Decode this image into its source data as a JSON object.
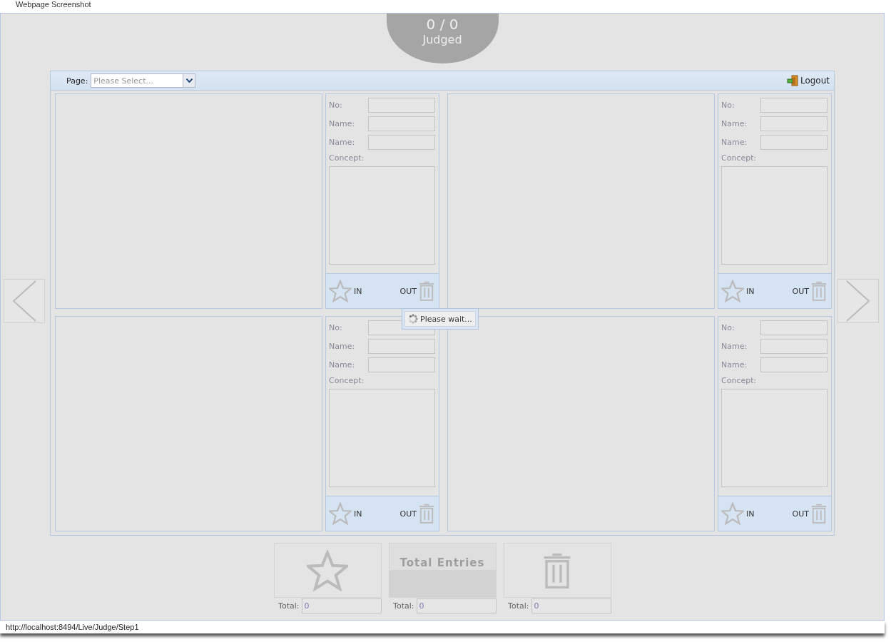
{
  "header": {
    "caption": "Webpage Screenshot"
  },
  "judged": {
    "count": "0 / 0",
    "label": "Judged"
  },
  "toolbar": {
    "page_label": "Page:",
    "page_select": {
      "placeholder": "Please Select..."
    },
    "logout": "Logout"
  },
  "entries": [
    {
      "fields": [
        {
          "label": "No:"
        },
        {
          "label": "Name:"
        },
        {
          "label": "Name:"
        }
      ],
      "concept_label": "Concept:",
      "in_label": "IN",
      "out_label": "OUT"
    },
    {
      "fields": [
        {
          "label": "No:"
        },
        {
          "label": "Name:"
        },
        {
          "label": "Name:"
        }
      ],
      "concept_label": "Concept:",
      "in_label": "IN",
      "out_label": "OUT"
    },
    {
      "fields": [
        {
          "label": "No:"
        },
        {
          "label": "Name:"
        },
        {
          "label": "Name:"
        }
      ],
      "concept_label": "Concept:",
      "in_label": "IN",
      "out_label": "OUT"
    },
    {
      "fields": [
        {
          "label": "No:"
        },
        {
          "label": "Name:"
        },
        {
          "label": "Name:"
        }
      ],
      "concept_label": "Concept:",
      "in_label": "IN",
      "out_label": "OUT"
    }
  ],
  "loading": {
    "text": "Please wait..."
  },
  "totals": [
    {
      "kind": "star",
      "label": "Total:",
      "value": "0"
    },
    {
      "kind": "entries",
      "caption": "Total Entries",
      "label": "Total:",
      "value": "0"
    },
    {
      "kind": "trash",
      "label": "Total:",
      "value": "0"
    }
  ],
  "status_bar": {
    "url": "http://localhost:8494/Live/Judge/Step1"
  }
}
